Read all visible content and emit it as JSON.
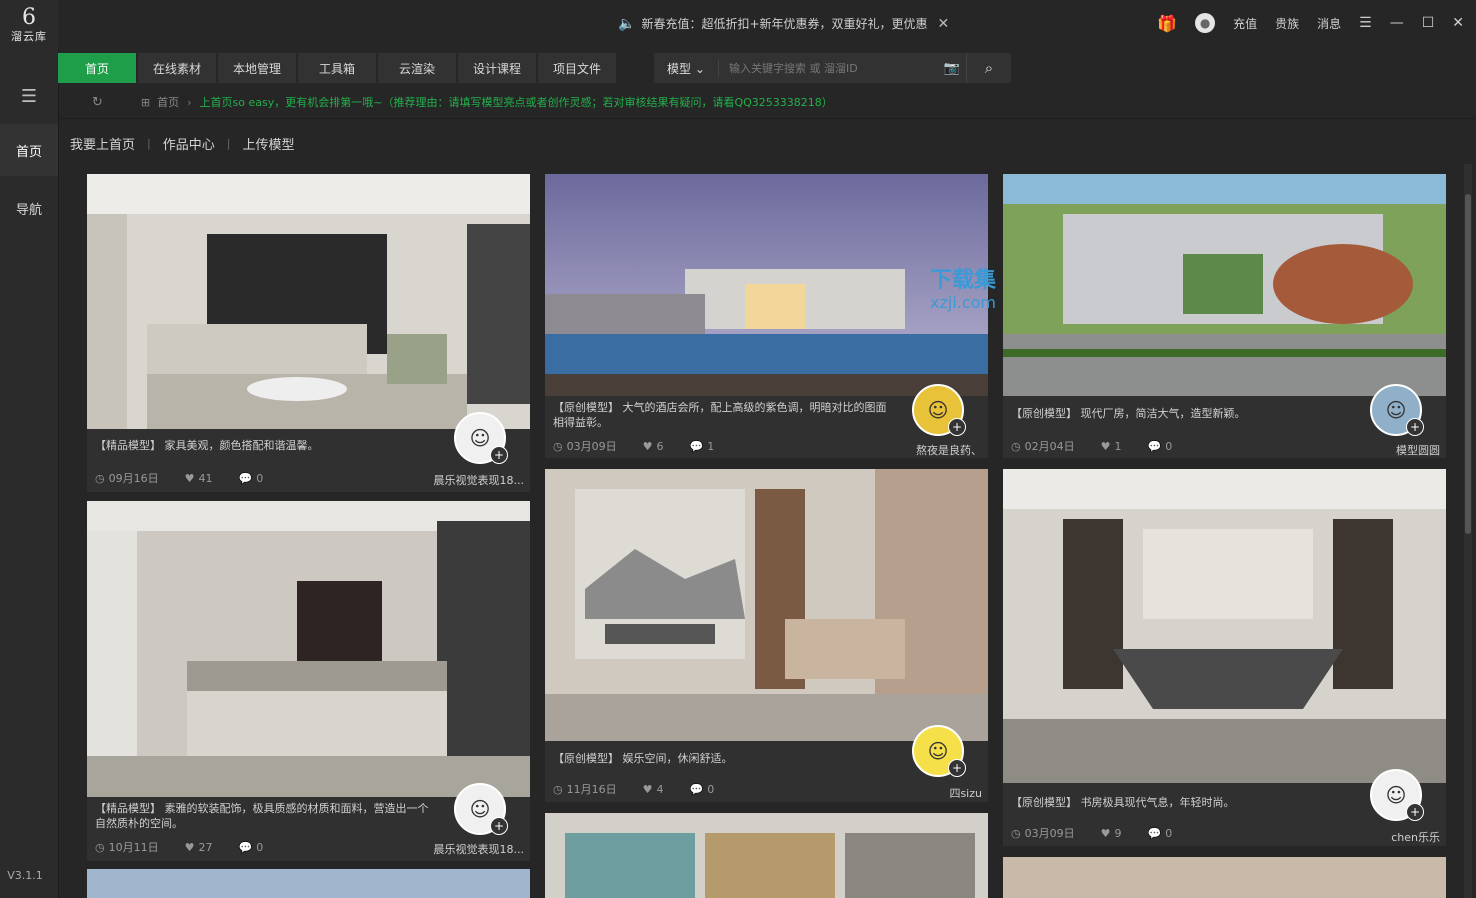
{
  "app": {
    "logo_mark": "6",
    "logo_name": "溜云库",
    "version": "V3.1.1"
  },
  "rail": {
    "menu_icon": "☰",
    "items": [
      {
        "label": "首页"
      },
      {
        "label": "导航"
      }
    ]
  },
  "promo": {
    "text": "新春充值：超低折扣+新年优惠券，双重好礼，更优惠"
  },
  "topright": {
    "recharge": "充值",
    "vip": "贵族",
    "message": "消息"
  },
  "tabs": [
    "首页",
    "在线素材",
    "本地管理",
    "工具箱",
    "云渲染",
    "设计课程",
    "项目文件"
  ],
  "search": {
    "type_label": "模型",
    "placeholder": "输入关键字搜索 或 溜溜ID"
  },
  "breadcrumb": {
    "home": "首页",
    "notice": "上首页so easy，更有机会排第一哦~（推荐理由：请填写模型亮点或者创作灵感；若对审核结果有疑问，请看QQ3253338218）"
  },
  "subnav": [
    "我要上首页",
    "作品中心",
    "上传模型"
  ],
  "watermark": {
    "line1": "下载集",
    "line2": "xzji.com"
  },
  "cards": [
    {
      "desc": "【精品模型】 家具美观，颜色搭配和谐温馨。",
      "date": "09月16日",
      "likes": "41",
      "comments": "0",
      "user": "晨乐视觉表现18..."
    },
    {
      "desc": "【精品模型】 素雅的软装配饰，极具质感的材质和面料，营造出一个自然质朴的空间。",
      "date": "10月11日",
      "likes": "27",
      "comments": "0",
      "user": "晨乐视觉表现18..."
    },
    {
      "desc": "【原创模型】 大气的酒店会所，配上高级的紫色调，明暗对比的图面相得益彰。",
      "date": "03月09日",
      "likes": "6",
      "comments": "1",
      "user": "熬夜是良药、"
    },
    {
      "desc": "【原创模型】 娱乐空间，休闲舒适。",
      "date": "11月16日",
      "likes": "4",
      "comments": "0",
      "user": "四sizu"
    },
    {
      "desc": "【原创模型】 现代厂房，简洁大气，造型新颖。",
      "date": "02月04日",
      "likes": "1",
      "comments": "0",
      "user": "模型圆圆"
    },
    {
      "desc": "【原创模型】 书房极具现代气息，年轻时尚。",
      "date": "03月09日",
      "likes": "9",
      "comments": "0",
      "user": "chen乐乐"
    }
  ]
}
